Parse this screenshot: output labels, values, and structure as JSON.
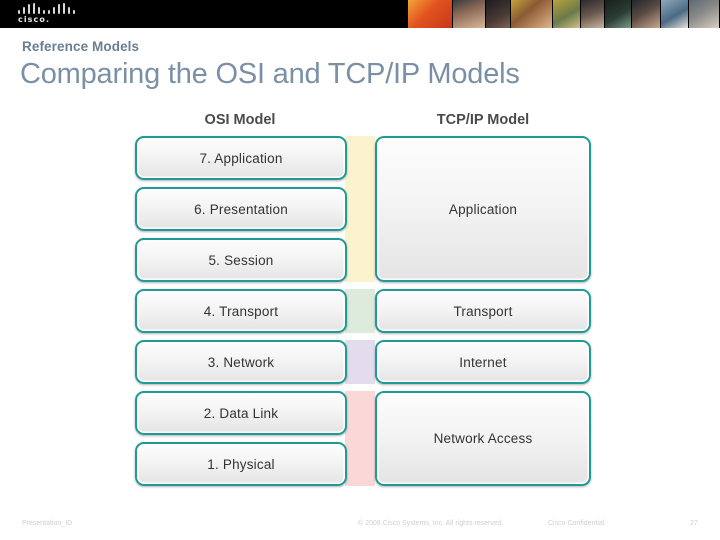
{
  "header": {
    "logo": {
      "name": "cisco-logo",
      "wordmark": "cisco."
    },
    "photo_strip_name": "people-photo-strip"
  },
  "slide": {
    "eyebrow": "Reference Models",
    "title": "Comparing the OSI and TCP/IP Models"
  },
  "diagram": {
    "osi_heading": "OSI Model",
    "tcpip_heading": "TCP/IP Model",
    "osi_layers": [
      {
        "label": "7. Application"
      },
      {
        "label": "6. Presentation"
      },
      {
        "label": "5. Session"
      },
      {
        "label": "4. Transport"
      },
      {
        "label": "3. Network"
      },
      {
        "label": "2. Data Link"
      },
      {
        "label": "1. Physical"
      }
    ],
    "tcpip_layers": [
      {
        "label": "Application",
        "spans": 3
      },
      {
        "label": "Transport",
        "spans": 1
      },
      {
        "label": "Internet",
        "spans": 1
      },
      {
        "label": "Network Access",
        "spans": 2
      }
    ],
    "bands": [
      {
        "name": "band-application",
        "color": "#fbf3ce",
        "spans": 3
      },
      {
        "name": "band-transport",
        "color": "#dcebdc",
        "spans": 1
      },
      {
        "name": "band-internet",
        "color": "#e3dcec",
        "spans": 1
      },
      {
        "name": "band-network-access",
        "color": "#fbd8d8",
        "spans": 2
      }
    ],
    "box_border_color": "#1f9a94"
  },
  "footer": {
    "presentation_id": "Presentation_ID",
    "copyright": "© 2008 Cisco Systems, Inc. All rights reserved.",
    "confidentiality": "Cisco Confidential",
    "page_number": "27"
  }
}
